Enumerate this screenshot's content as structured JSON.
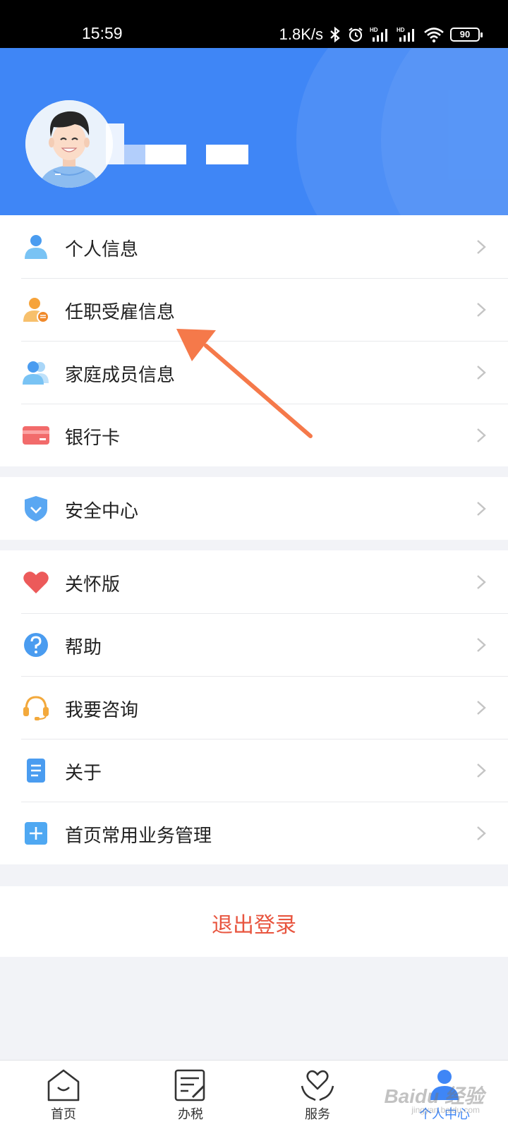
{
  "status_bar": {
    "time": "15:59",
    "network_speed": "1.8K/s",
    "battery": "90",
    "icons": [
      "bluetooth-icon",
      "alarm-icon",
      "signal-hd-icon",
      "signal-hd-icon",
      "wifi-icon",
      "battery-icon"
    ]
  },
  "profile": {
    "avatar_icon": "user-avatar-icon"
  },
  "menu_group_1": [
    {
      "label": "个人信息",
      "icon": "person-icon"
    },
    {
      "label": "任职受雇信息",
      "icon": "employment-info-icon"
    },
    {
      "label": "家庭成员信息",
      "icon": "family-members-icon"
    },
    {
      "label": "银行卡",
      "icon": "bank-card-icon"
    }
  ],
  "menu_group_2": [
    {
      "label": "安全中心",
      "icon": "shield-icon"
    }
  ],
  "menu_group_3": [
    {
      "label": "关怀版",
      "icon": "heart-icon"
    },
    {
      "label": "帮助",
      "icon": "help-icon"
    },
    {
      "label": "我要咨询",
      "icon": "headset-icon"
    },
    {
      "label": "关于",
      "icon": "document-icon"
    },
    {
      "label": "首页常用业务管理",
      "icon": "plus-square-icon"
    }
  ],
  "logout_label": "退出登录",
  "bottom_nav": [
    {
      "label": "首页",
      "icon": "home-icon"
    },
    {
      "label": "办税",
      "icon": "tax-form-icon"
    },
    {
      "label": "服务",
      "icon": "service-heart-icon"
    },
    {
      "label": "个人中心",
      "icon": "personal-center-icon",
      "active": true
    }
  ],
  "watermark": {
    "text": "Baidu 经验",
    "sub": "jingyan.baidu.com"
  },
  "colors": {
    "primary": "#3f86f6",
    "logout": "#e8553f",
    "arrow": "#f5794a"
  }
}
